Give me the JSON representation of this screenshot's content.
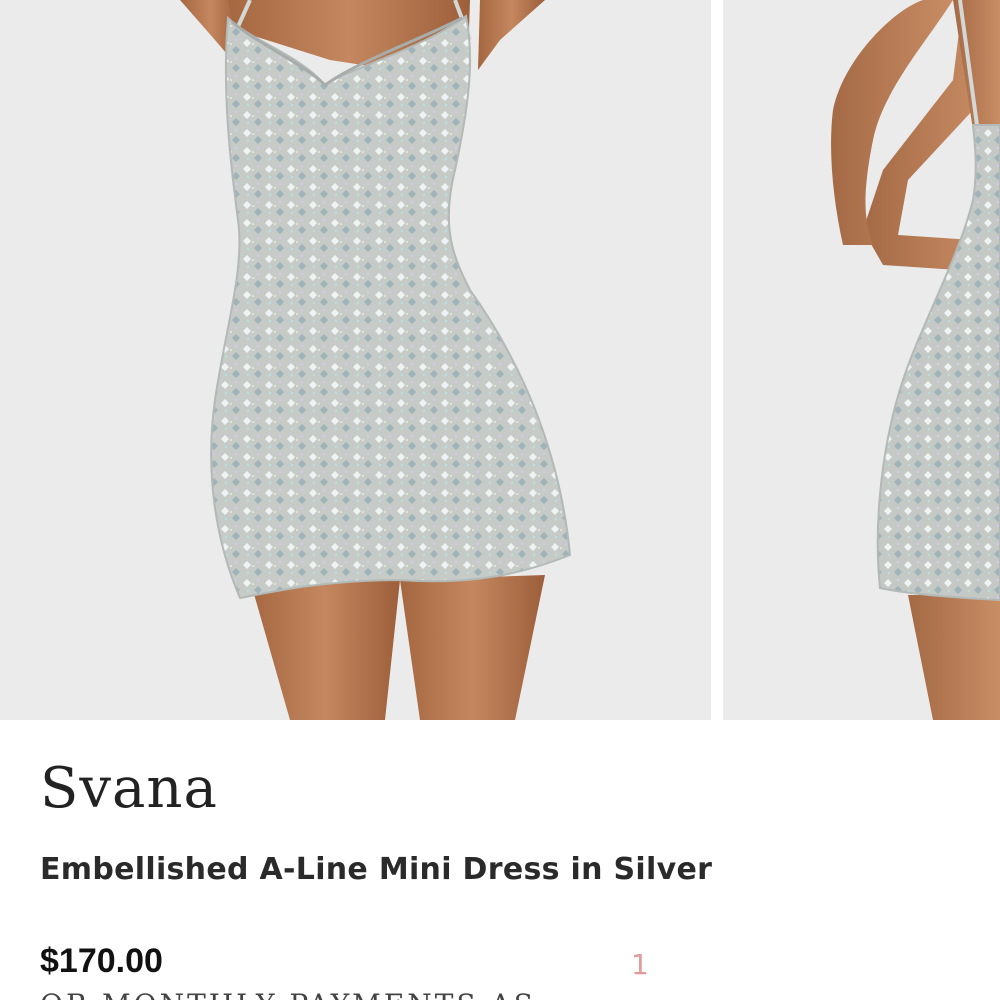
{
  "product": {
    "brand": "Svana",
    "name": "Embellished A-Line Mini Dress in Silver",
    "price": "$170.00",
    "installments_text": "OR MONTHLY PAYMENTS AS"
  },
  "gallery": {
    "image_counter": "1",
    "images": [
      {
        "view": "front"
      },
      {
        "view": "back"
      }
    ]
  },
  "colors": {
    "background": "#ebebec",
    "dress": "#c6cbc8",
    "skin": "#b97a55",
    "counter_accent": "#e29a9a"
  }
}
